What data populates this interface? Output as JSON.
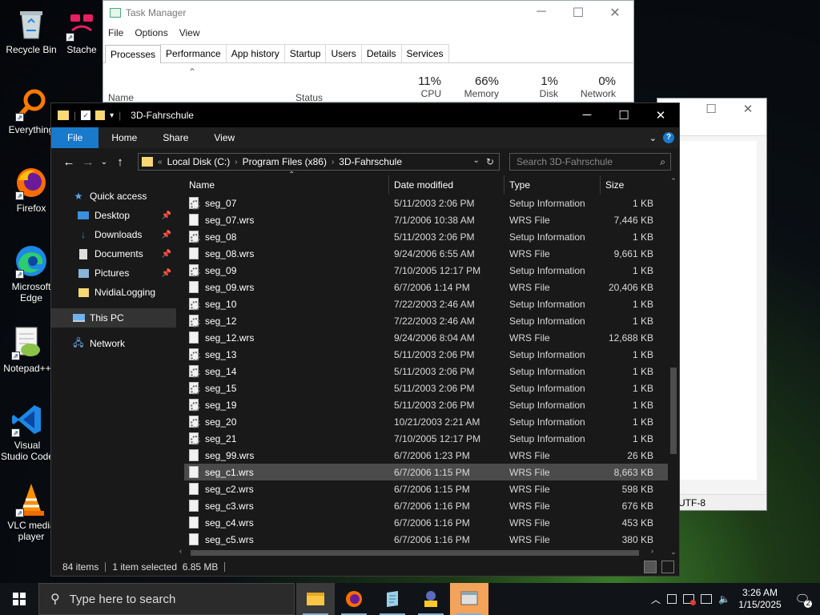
{
  "desktop": {
    "icons": [
      {
        "label": "Recycle Bin"
      },
      {
        "label": "Stache"
      },
      {
        "label": "Everything"
      },
      {
        "label": "Firefox"
      },
      {
        "label": "Microsoft Edge"
      },
      {
        "label": "Notepad++"
      },
      {
        "label": "Visual Studio Code"
      },
      {
        "label": "VLC media player"
      }
    ]
  },
  "task_manager": {
    "title": "Task Manager",
    "menu": [
      "File",
      "Options",
      "View"
    ],
    "tabs": [
      "Processes",
      "Performance",
      "App history",
      "Startup",
      "Users",
      "Details",
      "Services"
    ],
    "columns": {
      "name": "Name",
      "status": "Status",
      "cpu": {
        "pct": "11%",
        "label": "CPU"
      },
      "memory": {
        "pct": "66%",
        "label": "Memory"
      },
      "disk": {
        "pct": "1%",
        "label": "Disk"
      },
      "network": {
        "pct": "0%",
        "label": "Network"
      }
    }
  },
  "notepad": {
    "encoding": "UTF-8"
  },
  "explorer": {
    "title": "3D-Fahrschule",
    "ribbon": {
      "file": "File",
      "home": "Home",
      "share": "Share",
      "view": "View"
    },
    "breadcrumb": [
      "Local Disk (C:)",
      "Program Files (x86)",
      "3D-Fahrschule"
    ],
    "search_placeholder": "Search 3D-Fahrschule",
    "nav": {
      "quick_access": "Quick access",
      "desktop": "Desktop",
      "downloads": "Downloads",
      "documents": "Documents",
      "pictures": "Pictures",
      "nvidia": "NvidiaLogging",
      "this_pc": "This PC",
      "network": "Network"
    },
    "columns": {
      "name": "Name",
      "date": "Date modified",
      "type": "Type",
      "size": "Size"
    },
    "files": [
      {
        "name": "seg_07",
        "date": "5/11/2003 2:06 PM",
        "type": "Setup Information",
        "size": "1 KB",
        "kind": "inf"
      },
      {
        "name": "seg_07.wrs",
        "date": "7/1/2006 10:38 AM",
        "type": "WRS File",
        "size": "7,446 KB",
        "kind": "wrs"
      },
      {
        "name": "seg_08",
        "date": "5/11/2003 2:06 PM",
        "type": "Setup Information",
        "size": "1 KB",
        "kind": "inf"
      },
      {
        "name": "seg_08.wrs",
        "date": "9/24/2006 6:55 AM",
        "type": "WRS File",
        "size": "9,661 KB",
        "kind": "wrs"
      },
      {
        "name": "seg_09",
        "date": "7/10/2005 12:17 PM",
        "type": "Setup Information",
        "size": "1 KB",
        "kind": "inf"
      },
      {
        "name": "seg_09.wrs",
        "date": "6/7/2006 1:14 PM",
        "type": "WRS File",
        "size": "20,406 KB",
        "kind": "wrs"
      },
      {
        "name": "seg_10",
        "date": "7/22/2003 2:46 AM",
        "type": "Setup Information",
        "size": "1 KB",
        "kind": "inf"
      },
      {
        "name": "seg_12",
        "date": "7/22/2003 2:46 AM",
        "type": "Setup Information",
        "size": "1 KB",
        "kind": "inf"
      },
      {
        "name": "seg_12.wrs",
        "date": "9/24/2006 8:04 AM",
        "type": "WRS File",
        "size": "12,688 KB",
        "kind": "wrs"
      },
      {
        "name": "seg_13",
        "date": "5/11/2003 2:06 PM",
        "type": "Setup Information",
        "size": "1 KB",
        "kind": "inf"
      },
      {
        "name": "seg_14",
        "date": "5/11/2003 2:06 PM",
        "type": "Setup Information",
        "size": "1 KB",
        "kind": "inf"
      },
      {
        "name": "seg_15",
        "date": "5/11/2003 2:06 PM",
        "type": "Setup Information",
        "size": "1 KB",
        "kind": "inf"
      },
      {
        "name": "seg_19",
        "date": "5/11/2003 2:06 PM",
        "type": "Setup Information",
        "size": "1 KB",
        "kind": "inf"
      },
      {
        "name": "seg_20",
        "date": "10/21/2003 2:21 AM",
        "type": "Setup Information",
        "size": "1 KB",
        "kind": "inf"
      },
      {
        "name": "seg_21",
        "date": "7/10/2005 12:17 PM",
        "type": "Setup Information",
        "size": "1 KB",
        "kind": "inf"
      },
      {
        "name": "seg_99.wrs",
        "date": "6/7/2006 1:23 PM",
        "type": "WRS File",
        "size": "26 KB",
        "kind": "wrs"
      },
      {
        "name": "seg_c1.wrs",
        "date": "6/7/2006 1:15 PM",
        "type": "WRS File",
        "size": "8,663 KB",
        "kind": "wrs",
        "selected": true
      },
      {
        "name": "seg_c2.wrs",
        "date": "6/7/2006 1:15 PM",
        "type": "WRS File",
        "size": "598 KB",
        "kind": "wrs"
      },
      {
        "name": "seg_c3.wrs",
        "date": "6/7/2006 1:16 PM",
        "type": "WRS File",
        "size": "676 KB",
        "kind": "wrs"
      },
      {
        "name": "seg_c4.wrs",
        "date": "6/7/2006 1:16 PM",
        "type": "WRS File",
        "size": "453 KB",
        "kind": "wrs"
      },
      {
        "name": "seg_c5.wrs",
        "date": "6/7/2006 1:16 PM",
        "type": "WRS File",
        "size": "380 KB",
        "kind": "wrs"
      }
    ],
    "status": {
      "count": "84 items",
      "selection": "1 item selected  6.85 MB"
    }
  },
  "taskbar": {
    "search_placeholder": "Type here to search",
    "time": "3:26 AM",
    "date": "1/15/2025",
    "notification_count": "2"
  }
}
